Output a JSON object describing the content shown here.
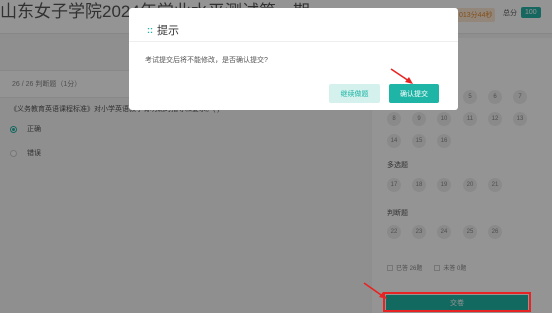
{
  "header": {
    "title": "山东女子学院2024年",
    "title_tail": "学业水平测试第一期",
    "timer": "013分44秒",
    "total_label": "总分",
    "total_badge": "100"
  },
  "question": {
    "progress": "26 / 26 判断题（1分）",
    "text": "《义务教育英语课程标准》对小学英语教学有明确的指导和要求。( )",
    "options": [
      {
        "label": "正确",
        "selected": true
      },
      {
        "label": "错误",
        "selected": false
      }
    ]
  },
  "answer_card": {
    "row1": [
      "5",
      "6",
      "7"
    ],
    "row2": [
      "8",
      "9",
      "10",
      "11",
      "12",
      "13"
    ],
    "row3": [
      "14",
      "15",
      "16"
    ],
    "multi_title": "多选题",
    "multi": [
      "17",
      "18",
      "19",
      "20",
      "21"
    ],
    "judge_title": "判断题",
    "judge": [
      "22",
      "23",
      "24",
      "25",
      "26"
    ],
    "answered": "已答 26题",
    "unanswered": "未答 0题",
    "submit_label": "交卷"
  },
  "modal": {
    "icon": "::",
    "title": "提示",
    "message": "考试提交后将不能修改，是否确认提交?",
    "continue_label": "继续做题",
    "confirm_label": "确认提交"
  },
  "colors": {
    "accent": "#1fb5a6",
    "highlight": "#e82323"
  }
}
